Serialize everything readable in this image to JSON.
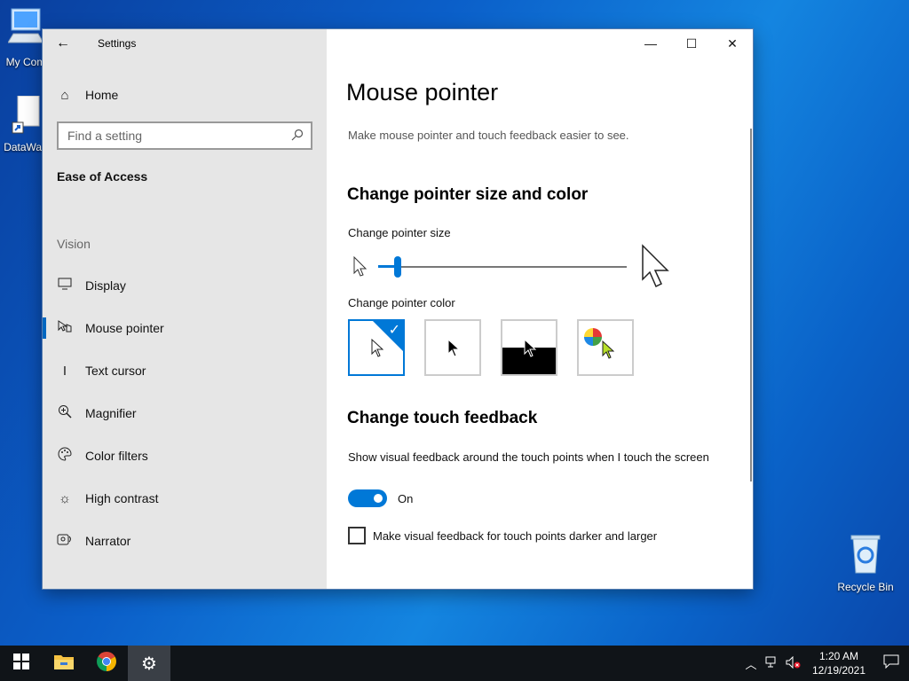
{
  "desktop": {
    "icons": [
      {
        "label": "My Com"
      },
      {
        "label": "DataWag"
      },
      {
        "label": "Recycle Bin"
      }
    ]
  },
  "window": {
    "app_title": "Settings",
    "controls": {
      "minimize": "—",
      "maximize": "☐",
      "close": "✕"
    }
  },
  "sidebar": {
    "home_label": "Home",
    "search_placeholder": "Find a setting",
    "category": "Ease of Access",
    "group_label": "Vision",
    "items": [
      {
        "label": "Display",
        "icon": "monitor-icon"
      },
      {
        "label": "Mouse pointer",
        "icon": "pointer-hand-icon",
        "active": true
      },
      {
        "label": "Text cursor",
        "icon": "text-cursor-icon"
      },
      {
        "label": "Magnifier",
        "icon": "magnifier-icon"
      },
      {
        "label": "Color filters",
        "icon": "palette-icon"
      },
      {
        "label": "High contrast",
        "icon": "contrast-icon"
      },
      {
        "label": "Narrator",
        "icon": "narrator-icon"
      }
    ]
  },
  "main": {
    "title": "Mouse pointer",
    "description": "Make mouse pointer and touch feedback easier to see.",
    "size_section": {
      "heading": "Change pointer size and color",
      "size_label": "Change pointer size",
      "size_level": 0.08,
      "color_label": "Change pointer color",
      "colors": [
        {
          "name": "white",
          "selected": true
        },
        {
          "name": "black",
          "selected": false
        },
        {
          "name": "inverted",
          "selected": false
        },
        {
          "name": "custom",
          "selected": false
        }
      ]
    },
    "touch_section": {
      "heading": "Change touch feedback",
      "visual_feedback_label": "Show visual feedback around the touch points when I touch the screen",
      "toggle_state": "On",
      "darker_label": "Make visual feedback for touch points darker and larger",
      "darker_checked": false
    }
  },
  "taskbar": {
    "clock_time": "1:20 AM",
    "clock_date": "12/19/2021"
  },
  "colors": {
    "accent": "#0078d7",
    "sidebar_bg": "#e6e6e6",
    "taskbar_bg": "#101418"
  }
}
